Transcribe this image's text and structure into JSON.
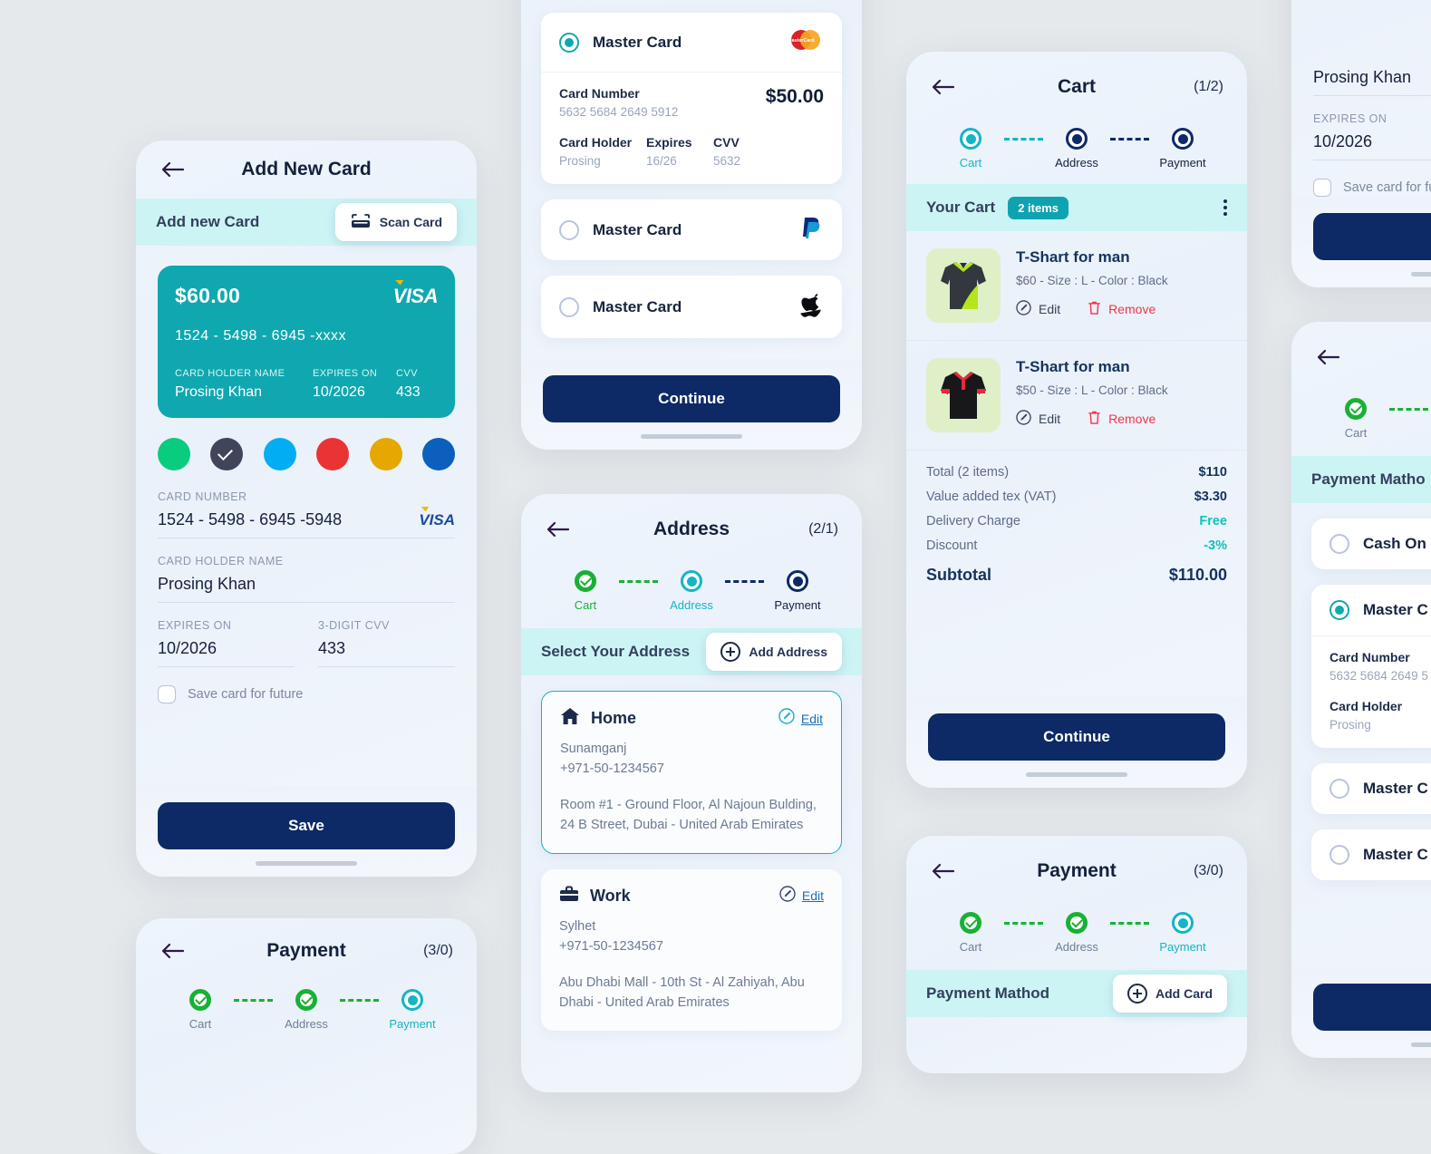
{
  "theme": {
    "bg": "#e5e9ec",
    "teal": "#0fa8b0",
    "teal_light": "#cdf4f5",
    "navy": "#0d2a66",
    "green": "#19b135",
    "red": "#f5334a",
    "panel": "#eef4fc"
  },
  "add_card_screen": {
    "title": "Add New Card",
    "back_icon": "arrow-left-icon",
    "section_title": "Add new Card",
    "scan_button": "Scan Card",
    "scan_icon": "scan-card-icon",
    "card_preview": {
      "amount": "$60.00",
      "brand": "VISA",
      "number": "1524 - 5498 - 6945  -xxxx",
      "holder_label": "CARD HOLDER NAME",
      "expires_label": "EXPIRES ON",
      "cvv_label": "CVV",
      "holder": "Prosing Khan",
      "expires": "10/2026",
      "cvv": "433"
    },
    "swatches": [
      {
        "color": "#09cc7f",
        "selected": false
      },
      {
        "color": "#414559",
        "selected": true
      },
      {
        "color": "#03adf4",
        "selected": false
      },
      {
        "color": "#ea3434",
        "selected": false
      },
      {
        "color": "#e5a700",
        "selected": false
      },
      {
        "color": "#0b60bd",
        "selected": false
      }
    ],
    "fields": {
      "card_number_label": "CARD NUMBER",
      "card_number_value": "1524 - 5498 - 6945  -5948",
      "card_number_brand": "VISA",
      "holder_label": "CARD HOLDER NAME",
      "holder_value": "Prosing Khan",
      "expires_label": "EXPIRES ON",
      "expires_value": "10/2026",
      "cvv_label": "3-DIGIT CVV",
      "cvv_value": "433"
    },
    "save_checkbox_label": "Save card for future",
    "save_button": "Save"
  },
  "payment_methods_screen": {
    "cards": [
      {
        "name": "Master Card",
        "logo": "mastercard-icon",
        "selected": true,
        "expanded": true,
        "card_number_label": "Card Number",
        "card_number_value": "5632 5684 2649 5912",
        "amount": "$50.00",
        "holder_label": "Card Holder",
        "holder_value": "Prosing",
        "expires_label": "Expires",
        "expires_value": "16/26",
        "cvv_label": "CVV",
        "cvv_value": "5632"
      },
      {
        "name": "Master Card",
        "logo": "paypal-icon",
        "selected": false,
        "expanded": false
      },
      {
        "name": "Master Card",
        "logo": "apple-icon",
        "selected": false,
        "expanded": false
      }
    ],
    "continue_button": "Continue"
  },
  "address_screen": {
    "title": "Address",
    "count": "(2/1)",
    "back_icon": "arrow-left-icon",
    "steps": [
      {
        "label": "Cart",
        "state": "done"
      },
      {
        "label": "Address",
        "state": "active"
      },
      {
        "label": "Payment",
        "state": "pending"
      }
    ],
    "section_title": "Select Your Address",
    "add_button": "Add Address",
    "add_icon": "plus-circle-icon",
    "addresses": [
      {
        "icon": "home-icon",
        "name": "Home",
        "edit_label": "Edit",
        "edit_icon": "pencil-icon",
        "city": "Sunamganj",
        "phone": "+971-50-1234567",
        "full": "Room #1 - Ground Floor, Al Najoun Bulding, 24 B Street, Dubai - United Arab Emirates",
        "selected": true
      },
      {
        "icon": "briefcase-icon",
        "name": "Work",
        "edit_label": "Edit",
        "edit_icon": "pencil-icon",
        "city": "Sylhet",
        "phone": "+971-50-1234567",
        "full": "Abu Dhabi Mall - 10th St - Al Zahiyah, Abu Dhabi - United Arab Emirates",
        "selected": false
      }
    ]
  },
  "cart_screen": {
    "title": "Cart",
    "count": "(1/2)",
    "back_icon": "arrow-left-icon",
    "steps": [
      {
        "label": "Cart",
        "state": "active"
      },
      {
        "label": "Address",
        "state": "pending"
      },
      {
        "label": "Payment",
        "state": "pending"
      }
    ],
    "section_title": "Your Cart",
    "items_badge": "2 items",
    "menu_icon": "kebab-menu-icon",
    "items": [
      {
        "name": "T-Shart for man",
        "meta": "$60 - Size : L - Color : Black",
        "edit_label": "Edit",
        "edit_icon": "pencil-icon",
        "remove_label": "Remove",
        "remove_icon": "trash-icon",
        "thumb": "polo-shirt-green-icon"
      },
      {
        "name": "T-Shart for man",
        "meta": "$50 - Size : L - Color : Black",
        "edit_label": "Edit",
        "edit_icon": "pencil-icon",
        "remove_label": "Remove",
        "remove_icon": "trash-icon",
        "thumb": "polo-shirt-red-icon"
      }
    ],
    "totals": [
      {
        "label": "Total (2 items)",
        "value": "$110",
        "accent": false
      },
      {
        "label": "Value added tex (VAT)",
        "value": "$3.30",
        "accent": false
      },
      {
        "label": "Delivery Charge",
        "value": "Free",
        "accent": true
      },
      {
        "label": "Discount",
        "value": "-3%",
        "accent": true
      }
    ],
    "subtotal_label": "Subtotal",
    "subtotal_value": "$110.00",
    "continue_button": "Continue"
  },
  "payment_screen_bottom": {
    "title": "Payment",
    "count": "(3/0)",
    "back_icon": "arrow-left-icon",
    "steps": [
      {
        "label": "Cart",
        "state": "done"
      },
      {
        "label": "Address",
        "state": "done"
      },
      {
        "label": "Payment",
        "state": "active"
      }
    ],
    "section_title": "Payment Mathod",
    "add_button": "Add Card",
    "add_icon": "plus-circle-icon"
  },
  "payment_screen_left": {
    "title": "Payment",
    "count": "(3/0)",
    "back_icon": "arrow-left-icon",
    "steps": [
      {
        "label": "Cart",
        "state": "done"
      },
      {
        "label": "Address",
        "state": "done"
      },
      {
        "label": "Payment",
        "state": "active"
      }
    ]
  },
  "right_partial_top": {
    "holder_value": "Prosing Khan",
    "expires_label": "EXPIRES ON",
    "expires_value": "10/2026",
    "checkbox_label": "Save card for fu"
  },
  "right_partial_bottom": {
    "back_icon": "arrow-left-icon",
    "step_label": "Cart",
    "section_title": "Payment Matho",
    "options": [
      {
        "name": "Cash On",
        "selected": false,
        "expanded": false
      },
      {
        "name": "Master C",
        "selected": true,
        "expanded": true,
        "card_number_label": "Card Number",
        "card_number_value": "5632 5684 2649 5",
        "holder_label": "Card Holder",
        "holder_value": "Prosing"
      },
      {
        "name": "Master C",
        "selected": false,
        "expanded": false
      },
      {
        "name": "Master C",
        "selected": false,
        "expanded": false
      }
    ]
  }
}
